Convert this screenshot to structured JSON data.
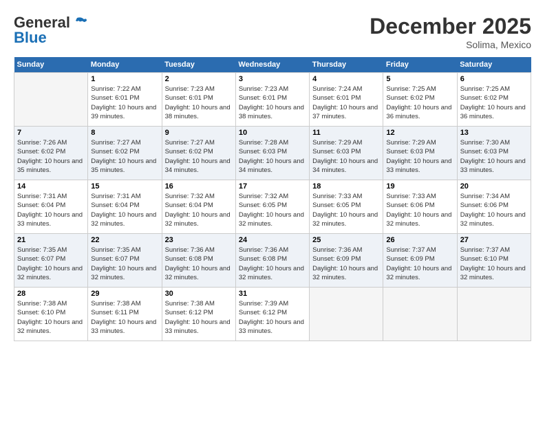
{
  "header": {
    "logo_general": "General",
    "logo_blue": "Blue",
    "month_year": "December 2025",
    "location": "Solima, Mexico"
  },
  "weekdays": [
    "Sunday",
    "Monday",
    "Tuesday",
    "Wednesday",
    "Thursday",
    "Friday",
    "Saturday"
  ],
  "rows": [
    [
      {
        "day": "",
        "data": null,
        "empty": true
      },
      {
        "day": "1",
        "data": {
          "sunrise": "7:22 AM",
          "sunset": "6:01 PM",
          "daylight": "10 hours and 39 minutes."
        }
      },
      {
        "day": "2",
        "data": {
          "sunrise": "7:23 AM",
          "sunset": "6:01 PM",
          "daylight": "10 hours and 38 minutes."
        }
      },
      {
        "day": "3",
        "data": {
          "sunrise": "7:23 AM",
          "sunset": "6:01 PM",
          "daylight": "10 hours and 38 minutes."
        }
      },
      {
        "day": "4",
        "data": {
          "sunrise": "7:24 AM",
          "sunset": "6:01 PM",
          "daylight": "10 hours and 37 minutes."
        }
      },
      {
        "day": "5",
        "data": {
          "sunrise": "7:25 AM",
          "sunset": "6:02 PM",
          "daylight": "10 hours and 36 minutes."
        }
      },
      {
        "day": "6",
        "data": {
          "sunrise": "7:25 AM",
          "sunset": "6:02 PM",
          "daylight": "10 hours and 36 minutes."
        }
      }
    ],
    [
      {
        "day": "7",
        "data": {
          "sunrise": "7:26 AM",
          "sunset": "6:02 PM",
          "daylight": "10 hours and 35 minutes."
        }
      },
      {
        "day": "8",
        "data": {
          "sunrise": "7:27 AM",
          "sunset": "6:02 PM",
          "daylight": "10 hours and 35 minutes."
        }
      },
      {
        "day": "9",
        "data": {
          "sunrise": "7:27 AM",
          "sunset": "6:02 PM",
          "daylight": "10 hours and 34 minutes."
        }
      },
      {
        "day": "10",
        "data": {
          "sunrise": "7:28 AM",
          "sunset": "6:03 PM",
          "daylight": "10 hours and 34 minutes."
        }
      },
      {
        "day": "11",
        "data": {
          "sunrise": "7:29 AM",
          "sunset": "6:03 PM",
          "daylight": "10 hours and 34 minutes."
        }
      },
      {
        "day": "12",
        "data": {
          "sunrise": "7:29 AM",
          "sunset": "6:03 PM",
          "daylight": "10 hours and 33 minutes."
        }
      },
      {
        "day": "13",
        "data": {
          "sunrise": "7:30 AM",
          "sunset": "6:03 PM",
          "daylight": "10 hours and 33 minutes."
        }
      }
    ],
    [
      {
        "day": "14",
        "data": {
          "sunrise": "7:31 AM",
          "sunset": "6:04 PM",
          "daylight": "10 hours and 33 minutes."
        }
      },
      {
        "day": "15",
        "data": {
          "sunrise": "7:31 AM",
          "sunset": "6:04 PM",
          "daylight": "10 hours and 32 minutes."
        }
      },
      {
        "day": "16",
        "data": {
          "sunrise": "7:32 AM",
          "sunset": "6:04 PM",
          "daylight": "10 hours and 32 minutes."
        }
      },
      {
        "day": "17",
        "data": {
          "sunrise": "7:32 AM",
          "sunset": "6:05 PM",
          "daylight": "10 hours and 32 minutes."
        }
      },
      {
        "day": "18",
        "data": {
          "sunrise": "7:33 AM",
          "sunset": "6:05 PM",
          "daylight": "10 hours and 32 minutes."
        }
      },
      {
        "day": "19",
        "data": {
          "sunrise": "7:33 AM",
          "sunset": "6:06 PM",
          "daylight": "10 hours and 32 minutes."
        }
      },
      {
        "day": "20",
        "data": {
          "sunrise": "7:34 AM",
          "sunset": "6:06 PM",
          "daylight": "10 hours and 32 minutes."
        }
      }
    ],
    [
      {
        "day": "21",
        "data": {
          "sunrise": "7:35 AM",
          "sunset": "6:07 PM",
          "daylight": "10 hours and 32 minutes."
        }
      },
      {
        "day": "22",
        "data": {
          "sunrise": "7:35 AM",
          "sunset": "6:07 PM",
          "daylight": "10 hours and 32 minutes."
        }
      },
      {
        "day": "23",
        "data": {
          "sunrise": "7:36 AM",
          "sunset": "6:08 PM",
          "daylight": "10 hours and 32 minutes."
        }
      },
      {
        "day": "24",
        "data": {
          "sunrise": "7:36 AM",
          "sunset": "6:08 PM",
          "daylight": "10 hours and 32 minutes."
        }
      },
      {
        "day": "25",
        "data": {
          "sunrise": "7:36 AM",
          "sunset": "6:09 PM",
          "daylight": "10 hours and 32 minutes."
        }
      },
      {
        "day": "26",
        "data": {
          "sunrise": "7:37 AM",
          "sunset": "6:09 PM",
          "daylight": "10 hours and 32 minutes."
        }
      },
      {
        "day": "27",
        "data": {
          "sunrise": "7:37 AM",
          "sunset": "6:10 PM",
          "daylight": "10 hours and 32 minutes."
        }
      }
    ],
    [
      {
        "day": "28",
        "data": {
          "sunrise": "7:38 AM",
          "sunset": "6:10 PM",
          "daylight": "10 hours and 32 minutes."
        }
      },
      {
        "day": "29",
        "data": {
          "sunrise": "7:38 AM",
          "sunset": "6:11 PM",
          "daylight": "10 hours and 33 minutes."
        }
      },
      {
        "day": "30",
        "data": {
          "sunrise": "7:38 AM",
          "sunset": "6:12 PM",
          "daylight": "10 hours and 33 minutes."
        }
      },
      {
        "day": "31",
        "data": {
          "sunrise": "7:39 AM",
          "sunset": "6:12 PM",
          "daylight": "10 hours and 33 minutes."
        }
      },
      {
        "day": "",
        "data": null,
        "empty": true
      },
      {
        "day": "",
        "data": null,
        "empty": true
      },
      {
        "day": "",
        "data": null,
        "empty": true
      }
    ]
  ]
}
